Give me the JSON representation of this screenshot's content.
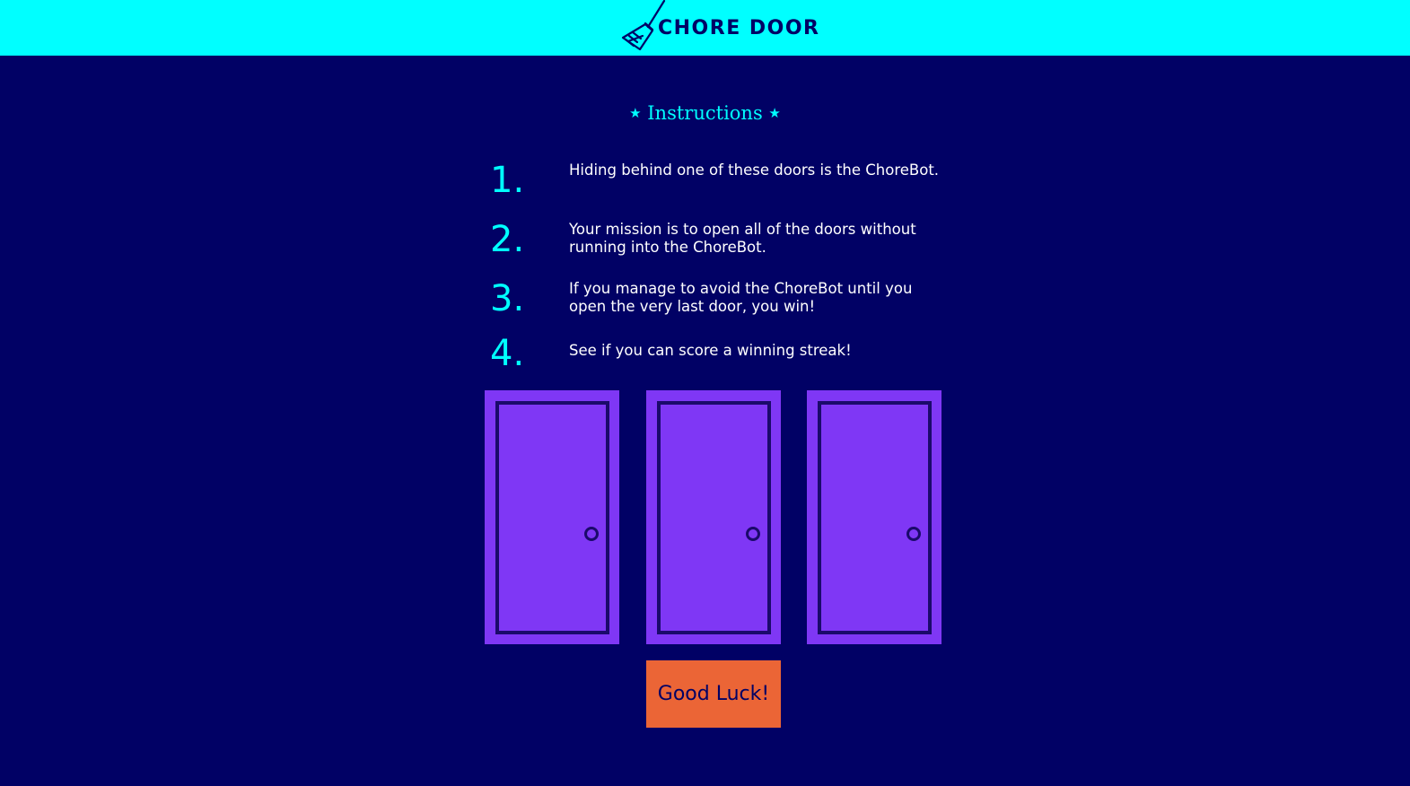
{
  "header": {
    "logo_icon": "broom-icon",
    "title": "CHORE DOOR"
  },
  "instructions": {
    "title": "Instructions",
    "star_glyph": "★",
    "steps": [
      {
        "number": "1.",
        "text": "Hiding behind one of these doors is the ChoreBot."
      },
      {
        "number": "2.",
        "text": "Your mission is to open all of the doors without running into the ChoreBot."
      },
      {
        "number": "3.",
        "text": "If you manage to avoid the ChoreBot until you open the very last door, you win!"
      },
      {
        "number": "4.",
        "text": "See if you can score a winning streak!"
      }
    ]
  },
  "doors": [
    {
      "icon": "closed-door-icon"
    },
    {
      "icon": "closed-door-icon"
    },
    {
      "icon": "closed-door-icon"
    }
  ],
  "start_button": {
    "label": "Good Luck!"
  },
  "colors": {
    "background": "#010165",
    "header": "#00ffff",
    "accent": "#00ffff",
    "door": "#7f37f5",
    "button": "#eb6536"
  }
}
